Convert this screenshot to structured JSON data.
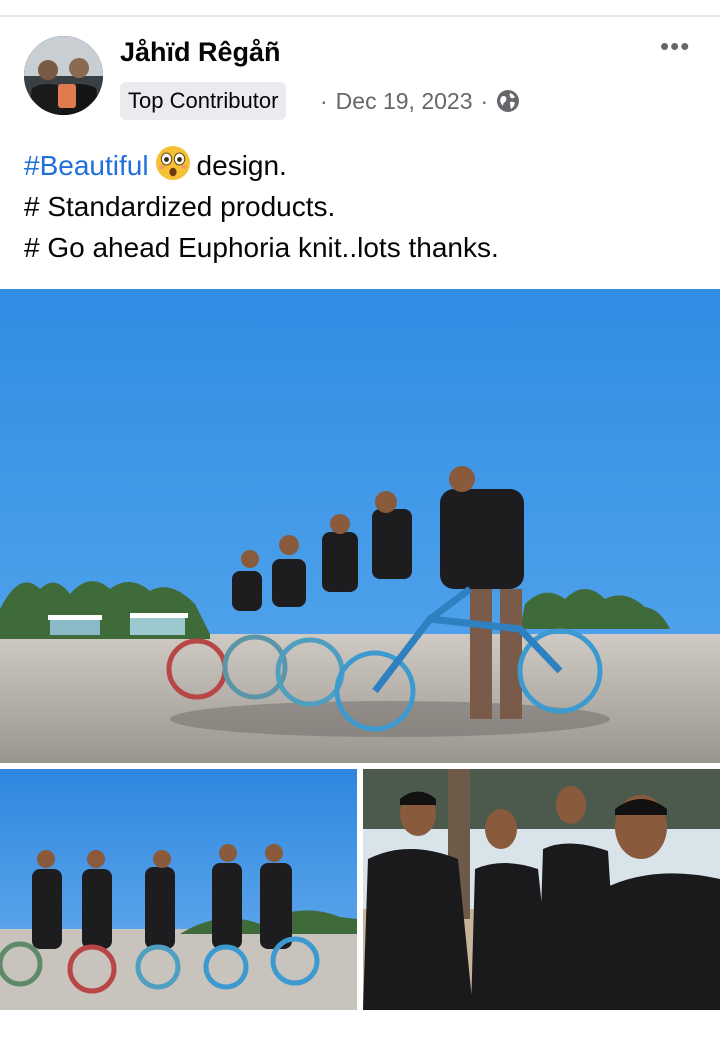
{
  "post": {
    "author": "Jåhïd Rêgåñ",
    "badge": "Top Contributor",
    "separator": "·",
    "date": "Dec 19, 2023",
    "privacy_icon": "globe-icon",
    "menu_icon": "more-horizontal-icon",
    "menu_label": "•••",
    "text": {
      "hashtag": "#Beautiful",
      "emoji": "astonished-face-emoji",
      "line1_rest": "design.",
      "line2": "# Standardized products.",
      "line3": "# Go ahead Euphoria knit..lots thanks."
    }
  },
  "colors": {
    "hashtag": "#216fdb",
    "meta_text": "#65676b",
    "badge_bg": "#e9ebee"
  }
}
